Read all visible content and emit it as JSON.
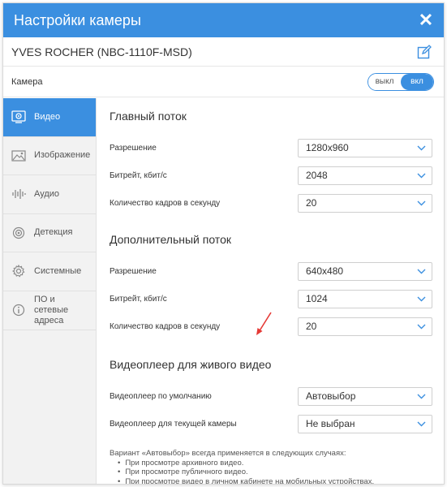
{
  "dialog": {
    "title": "Настройки камеры",
    "camera_name": "YVES ROCHER (NBC-1110F-MSD)",
    "camera_label": "Камера",
    "toggle": {
      "off": "выкл",
      "on": "вкл"
    }
  },
  "sidebar": {
    "items": [
      {
        "label": "Видео",
        "icon": "video-icon",
        "active": true
      },
      {
        "label": "Изображение",
        "icon": "image-icon",
        "active": false
      },
      {
        "label": "Аудио",
        "icon": "audio-icon",
        "active": false
      },
      {
        "label": "Детекция",
        "icon": "detection-icon",
        "active": false
      },
      {
        "label": "Системные",
        "icon": "gear-icon",
        "active": false
      },
      {
        "label": "ПО и сетевые адреса",
        "icon": "info-icon",
        "active": false
      }
    ]
  },
  "main_stream": {
    "title": "Главный поток",
    "resolution_label": "Разрешение",
    "resolution": "1280x960",
    "bitrate_label": "Битрейт, кбит/с",
    "bitrate": "2048",
    "fps_label": "Количество кадров в секунду",
    "fps": "20"
  },
  "sub_stream": {
    "title": "Дополнительный поток",
    "resolution_label": "Разрешение",
    "resolution": "640x480",
    "bitrate_label": "Битрейт, кбит/с",
    "bitrate": "1024",
    "fps_label": "Количество кадров в секунду",
    "fps": "20"
  },
  "player": {
    "title": "Видеоплеер для живого видео",
    "default_label": "Видеоплеер по умолчанию",
    "default_value": "Автовыбор",
    "current_label": "Видеоплеер для текущей камеры",
    "current_value": "Не выбран",
    "note_intro": "Вариант «Автовыбор» всегда применяется в следующих случаях:",
    "note_items": [
      "При просмотре архивного видео.",
      "При просмотре публичного видео.",
      "При просмотре видео в личном кабинете на мобильных устройствах."
    ]
  },
  "colors": {
    "accent": "#3b8fe0",
    "annotation_arrow": "#e53935"
  }
}
